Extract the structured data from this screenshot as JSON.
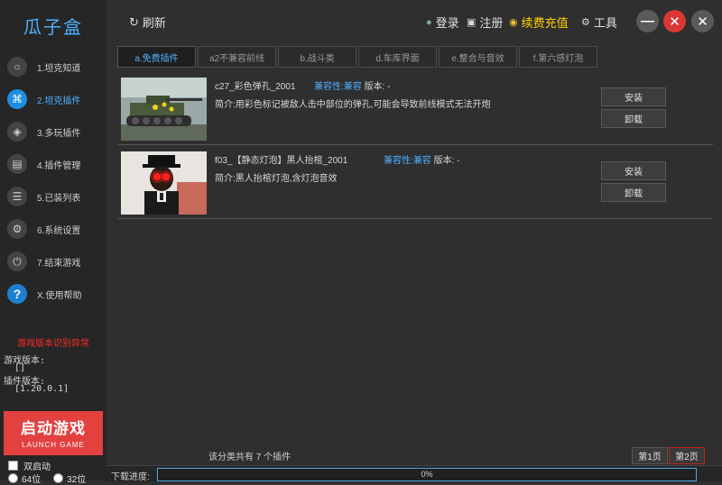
{
  "app": {
    "title": "瓜子盒"
  },
  "sidebar": {
    "items": [
      {
        "label": "1.坦克知道",
        "icon": "bulb-icon",
        "glyph": "○"
      },
      {
        "label": "2.坦克插件",
        "icon": "tank-radar-icon",
        "glyph": "⌘"
      },
      {
        "label": "3.多玩插件",
        "icon": "cube-icon",
        "glyph": "◈"
      },
      {
        "label": "4.插件管理",
        "icon": "document-icon",
        "glyph": "▤"
      },
      {
        "label": "5.已装列表",
        "icon": "list-icon",
        "glyph": "☰"
      },
      {
        "label": "6.系统设置",
        "icon": "gear-icon",
        "glyph": "⚙"
      },
      {
        "label": "7.结束游戏",
        "icon": "power-icon",
        "glyph": "⏻"
      },
      {
        "label": "X.使用帮助",
        "icon": "help-icon",
        "glyph": "?"
      }
    ],
    "active_index": 1,
    "warning": "游戏版本识别异常",
    "game_version_label": "游戏版本:",
    "game_version_value": "[]",
    "plugin_version_label": "插件版本:",
    "plugin_version_value": "[1.20.0.1]",
    "launch_label": "启动游戏",
    "launch_sub": "LAUNCH GAME",
    "dual_launch_label": "双启动",
    "bit64_label": "64位",
    "bit32_label": "32位"
  },
  "topbar": {
    "refresh_label": "刷新",
    "login_label": "登录",
    "register_label": "注册",
    "recharge_label": "续费充值",
    "tools_label": "工具"
  },
  "tabs": [
    {
      "label": "a.免费插件",
      "active": true
    },
    {
      "label": "a2不兼容前线",
      "active": false
    },
    {
      "label": "b.战斗类",
      "active": false
    },
    {
      "label": "d.车库界面",
      "active": false
    },
    {
      "label": "e.整合与音效",
      "active": false
    },
    {
      "label": "f.第六感灯泡",
      "active": false
    }
  ],
  "plugins": [
    {
      "name": "c27_彩色弹孔_2001",
      "compat_label": "兼容性:",
      "compat_value": "兼容",
      "version_label": "版本:",
      "version_value": "-",
      "desc": "简介:用彩色标记被敌人击中部位的弹孔,可能会导致前线模式无法开炮",
      "install_label": "安装",
      "uninstall_label": "卸载"
    },
    {
      "name": "f03_【静态灯泡】黑人抬棺_2001",
      "compat_label": "兼容性:",
      "compat_value": "兼容",
      "version_label": "版本:",
      "version_value": "-",
      "desc": "简介:黑人抬棺灯泡,含灯泡音效",
      "install_label": "安装",
      "uninstall_label": "卸载"
    }
  ],
  "footer": {
    "count_text": "该分类共有 7 个插件",
    "page1_label": "第1页",
    "page2_label": "第2页",
    "download_label": "下载进度:",
    "progress_text": "0%",
    "progress_value": 0
  },
  "colors": {
    "accent": "#1e8fe0",
    "recharge": "#ffd200",
    "warning": "#ff2a2a",
    "launch": "#e34040"
  }
}
